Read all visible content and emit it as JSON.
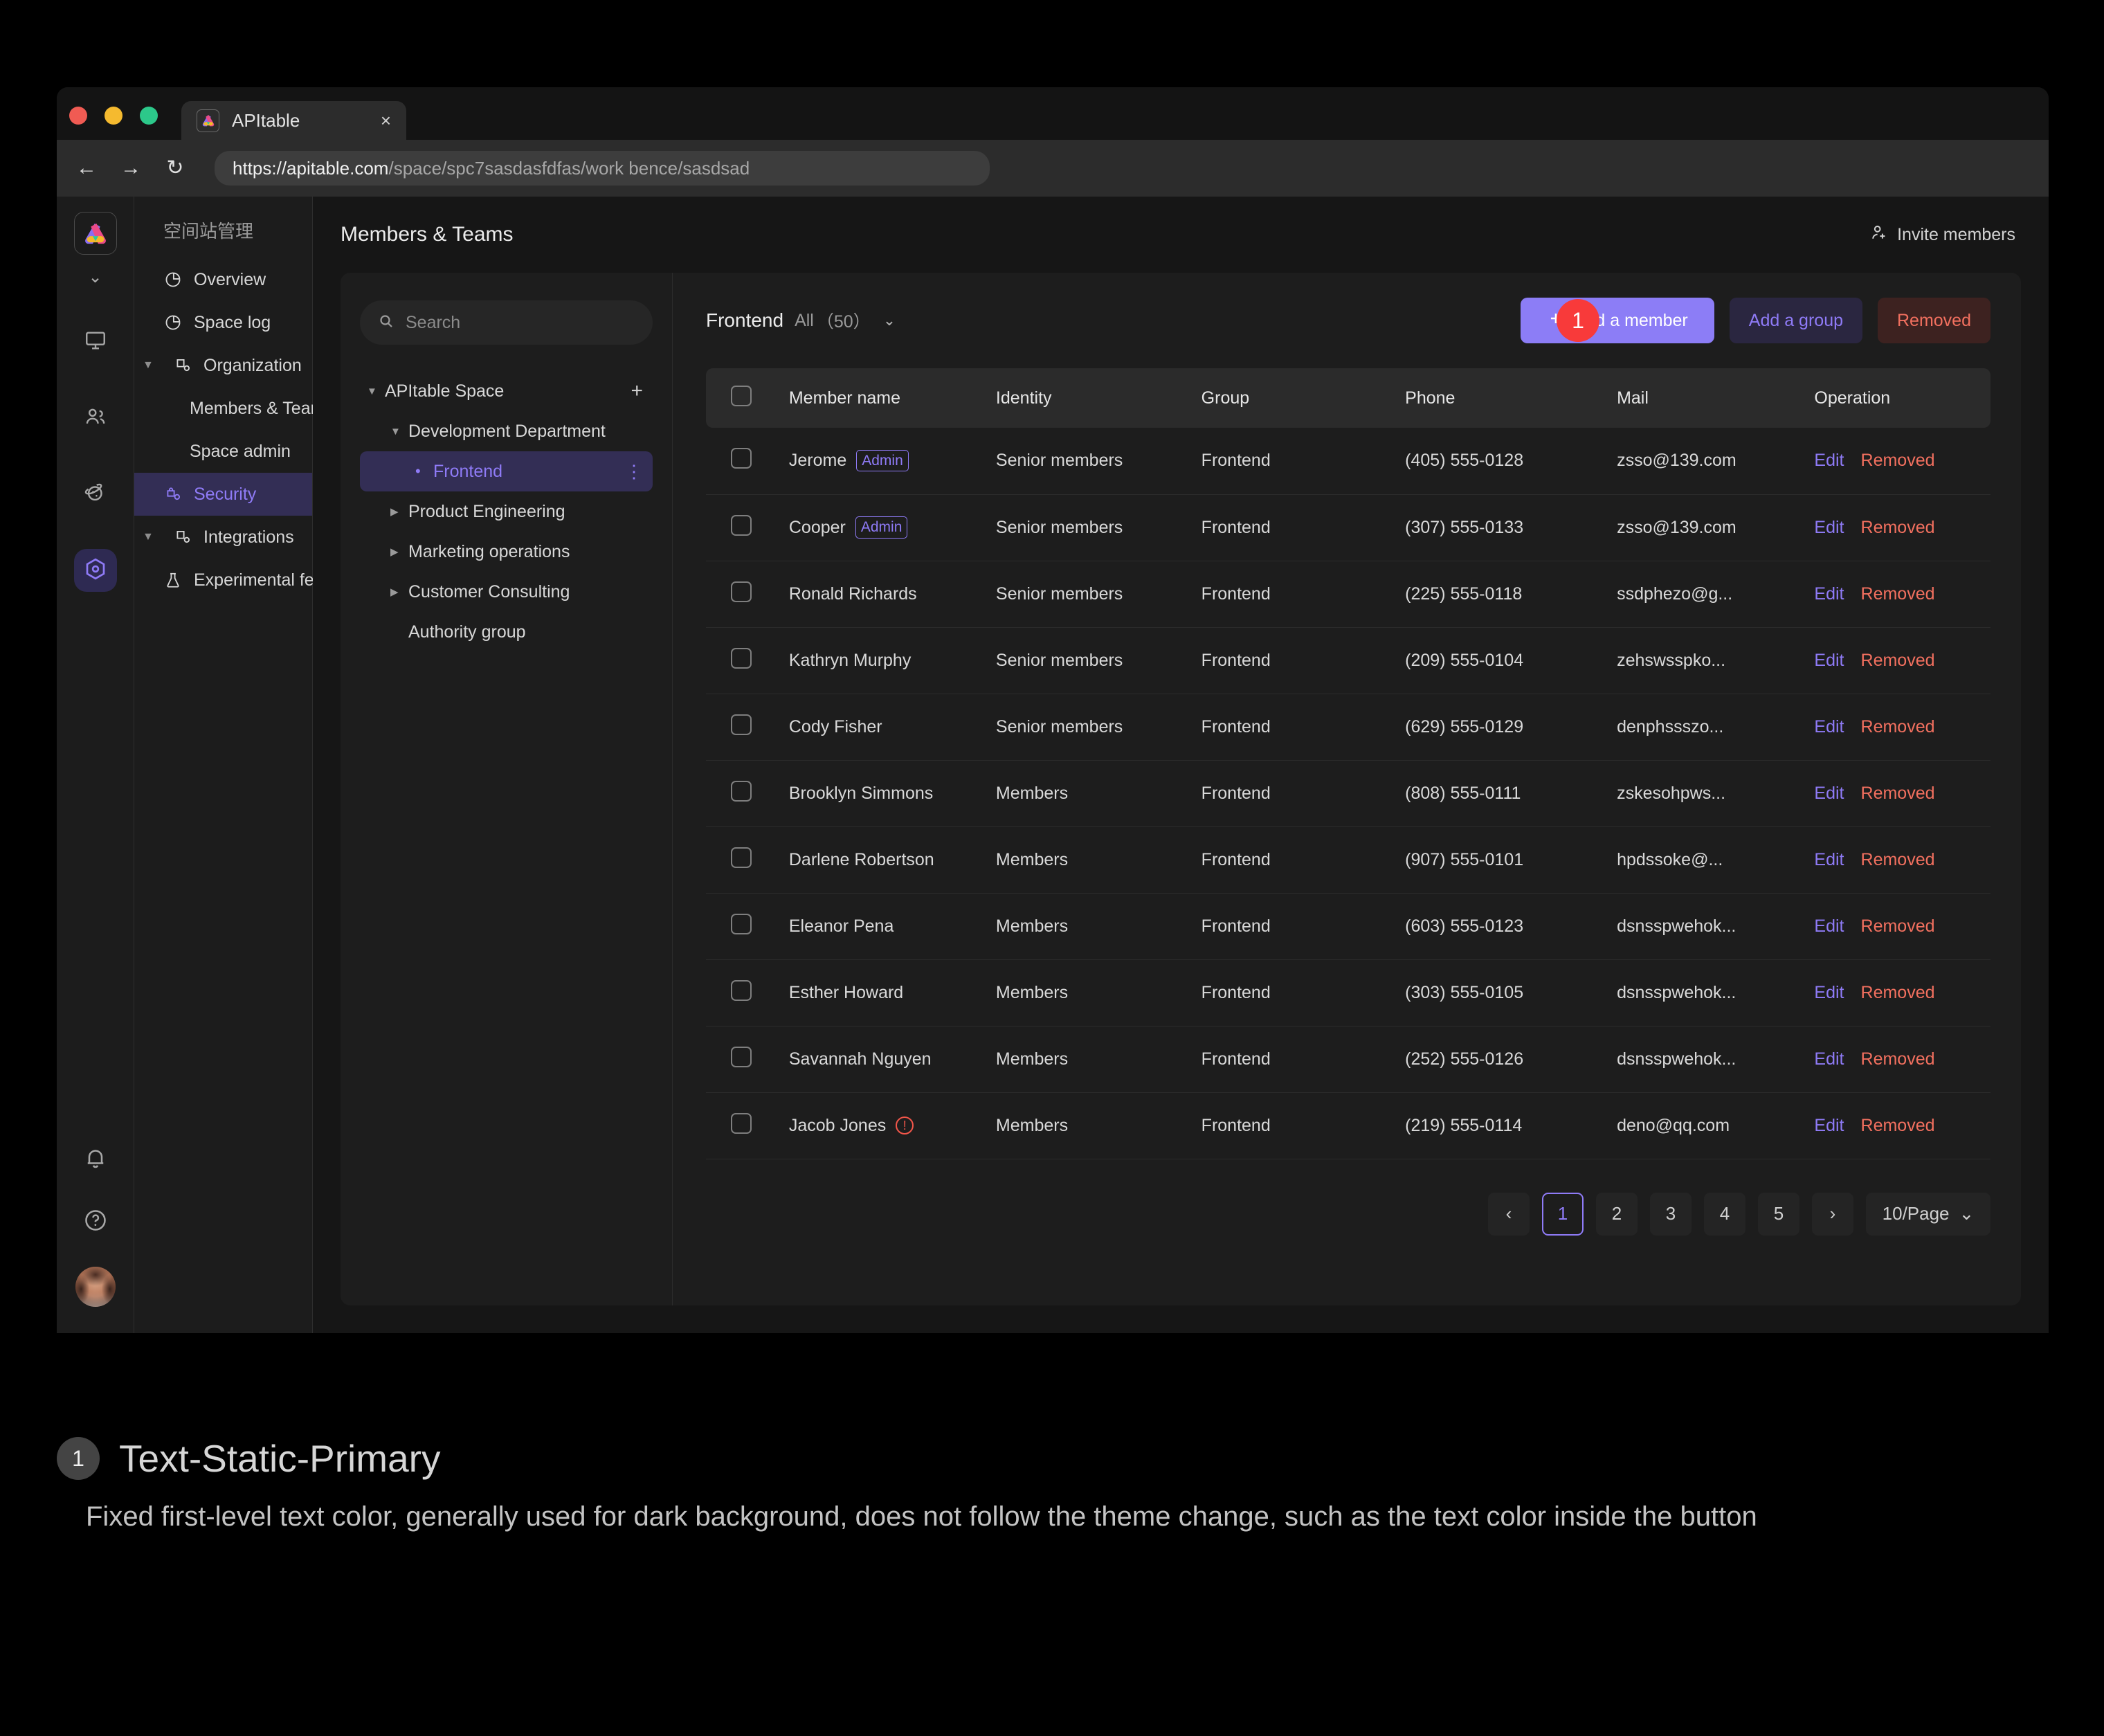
{
  "browser": {
    "tab": {
      "title": "APItable",
      "close_label": "×",
      "favicon": "apitable-logo-icon"
    },
    "nav": {
      "back": "←",
      "forward": "→",
      "reload": "↻"
    },
    "url": {
      "host": "https://apitable.com",
      "path": "/space/spc7sasdasfdfas/work bence/sasdsad"
    }
  },
  "rail": {
    "logo": "apitable-logo-icon",
    "caret": "⌄",
    "items": [
      {
        "icon": "monitor-icon",
        "active": false
      },
      {
        "icon": "members-icon",
        "active": false
      },
      {
        "icon": "planet-icon",
        "active": false
      },
      {
        "icon": "settings-hex-icon",
        "active": true
      }
    ],
    "bottom": [
      {
        "icon": "bell-icon"
      },
      {
        "icon": "help-circle-icon"
      }
    ],
    "avatar": "user-avatar"
  },
  "settings_nav": {
    "title": "空间站管理",
    "items": [
      {
        "label": "Overview",
        "icon": "pie-chart-icon",
        "level": 0,
        "caret": "",
        "active": false
      },
      {
        "label": "Space log",
        "icon": "pie-chart-icon",
        "level": 0,
        "caret": "",
        "active": false
      },
      {
        "label": "Organization",
        "icon": "org-icon",
        "level": 0,
        "caret": "▼",
        "active": false
      },
      {
        "label": "Members & Teams",
        "icon": "",
        "level": 1,
        "caret": "",
        "active": false
      },
      {
        "label": "Space admin",
        "icon": "",
        "level": 1,
        "caret": "",
        "active": false
      },
      {
        "label": "Security",
        "icon": "lock-org-icon",
        "level": 0,
        "caret": "",
        "active": true
      },
      {
        "label": "Integrations",
        "icon": "org-icon",
        "level": 0,
        "caret": "▼",
        "active": false
      },
      {
        "label": "Experimental features",
        "icon": "flask-icon",
        "level": 0,
        "caret": "",
        "active": false
      }
    ]
  },
  "header": {
    "title": "Members & Teams",
    "invite_label": "Invite members",
    "invite_icon": "add-person-icon"
  },
  "tree": {
    "search_placeholder": "Search",
    "search_icon": "search-icon",
    "add_icon": "+",
    "rows": [
      {
        "label": "APItable Space",
        "level": 0,
        "caret": "▼",
        "active": false,
        "trailing": "plus"
      },
      {
        "label": "Development Department",
        "level": 1,
        "caret": "▼",
        "active": false,
        "trailing": ""
      },
      {
        "label": "Frontend",
        "level": 2,
        "caret": "•",
        "active": true,
        "trailing": "more"
      },
      {
        "label": "Product Engineering",
        "level": 1,
        "caret": "▶",
        "active": false,
        "trailing": ""
      },
      {
        "label": "Marketing operations",
        "level": 1,
        "caret": "▶",
        "active": false,
        "trailing": ""
      },
      {
        "label": "Customer Consulting",
        "level": 1,
        "caret": "▶",
        "active": false,
        "trailing": ""
      },
      {
        "label": "Authority group",
        "level": 1,
        "caret": "",
        "active": false,
        "trailing": ""
      }
    ]
  },
  "table_panel": {
    "group_name": "Frontend",
    "filter_label": "All",
    "count_label": "（50）",
    "dropdown_caret": "⌄",
    "buttons": {
      "add_member": "Add a member",
      "add_member_icon": "plus-icon",
      "add_group": "Add a group",
      "removed": "Removed"
    },
    "annotation_badge": "1",
    "columns": [
      "Member name",
      "Identity",
      "Group",
      "Phone",
      "Mail",
      "Operation"
    ],
    "op_edit": "Edit",
    "op_remove": "Removed",
    "rows": [
      {
        "name": "Jerome",
        "tag": "Admin",
        "warn": false,
        "identity": "Senior members",
        "group": "Frontend",
        "phone": "(405) 555-0128",
        "mail": "zsso@139.com"
      },
      {
        "name": "Cooper",
        "tag": "Admin",
        "warn": false,
        "identity": "Senior members",
        "group": "Frontend",
        "phone": "(307) 555-0133",
        "mail": "zsso@139.com"
      },
      {
        "name": "Ronald Richards",
        "tag": "",
        "warn": false,
        "identity": "Senior members",
        "group": "Frontend",
        "phone": "(225) 555-0118",
        "mail": "ssdphezo@g..."
      },
      {
        "name": "Kathryn Murphy",
        "tag": "",
        "warn": false,
        "identity": "Senior members",
        "group": "Frontend",
        "phone": "(209) 555-0104",
        "mail": "zehswsspko..."
      },
      {
        "name": "Cody Fisher",
        "tag": "",
        "warn": false,
        "identity": "Senior members",
        "group": "Frontend",
        "phone": "(629) 555-0129",
        "mail": "denphssszo..."
      },
      {
        "name": "Brooklyn Simmons",
        "tag": "",
        "warn": false,
        "identity": "Members",
        "group": "Frontend",
        "phone": "(808) 555-0111",
        "mail": "zskesohpws..."
      },
      {
        "name": "Darlene Robertson",
        "tag": "",
        "warn": false,
        "identity": "Members",
        "group": "Frontend",
        "phone": "(907) 555-0101",
        "mail": "hpdssoke@..."
      },
      {
        "name": "Eleanor Pena",
        "tag": "",
        "warn": false,
        "identity": "Members",
        "group": "Frontend",
        "phone": "(603) 555-0123",
        "mail": "dsnsspwehok..."
      },
      {
        "name": "Esther Howard",
        "tag": "",
        "warn": false,
        "identity": "Members",
        "group": "Frontend",
        "phone": "(303) 555-0105",
        "mail": "dsnsspwehok..."
      },
      {
        "name": "Savannah Nguyen",
        "tag": "",
        "warn": false,
        "identity": "Members",
        "group": "Frontend",
        "phone": "(252) 555-0126",
        "mail": "dsnsspwehok..."
      },
      {
        "name": "Jacob Jones",
        "tag": "",
        "warn": true,
        "identity": "Members",
        "group": "Frontend",
        "phone": "(219) 555-0114",
        "mail": "deno@qq.com"
      }
    ],
    "pagination": {
      "prev": "‹",
      "next": "›",
      "pages": [
        "1",
        "2",
        "3",
        "4",
        "5"
      ],
      "current": "1",
      "page_size": "10/Page",
      "page_size_caret": "⌄"
    }
  },
  "annotation": {
    "number": "1",
    "title": "Text-Static-Primary",
    "body": "Fixed first-level text color, generally used for dark background, does not follow the theme change, such as the text color inside the button"
  },
  "colors": {
    "accent_purple": "#8C7DF6",
    "accent_purple_text": "#8F7BF7",
    "badge_red": "#F83A3A",
    "danger_text": "#F2705F",
    "danger_bg": "#3D2220",
    "secondary_bg": "#2A2640",
    "window_bg": "#191919",
    "panel_bg": "#1D1D1D"
  }
}
